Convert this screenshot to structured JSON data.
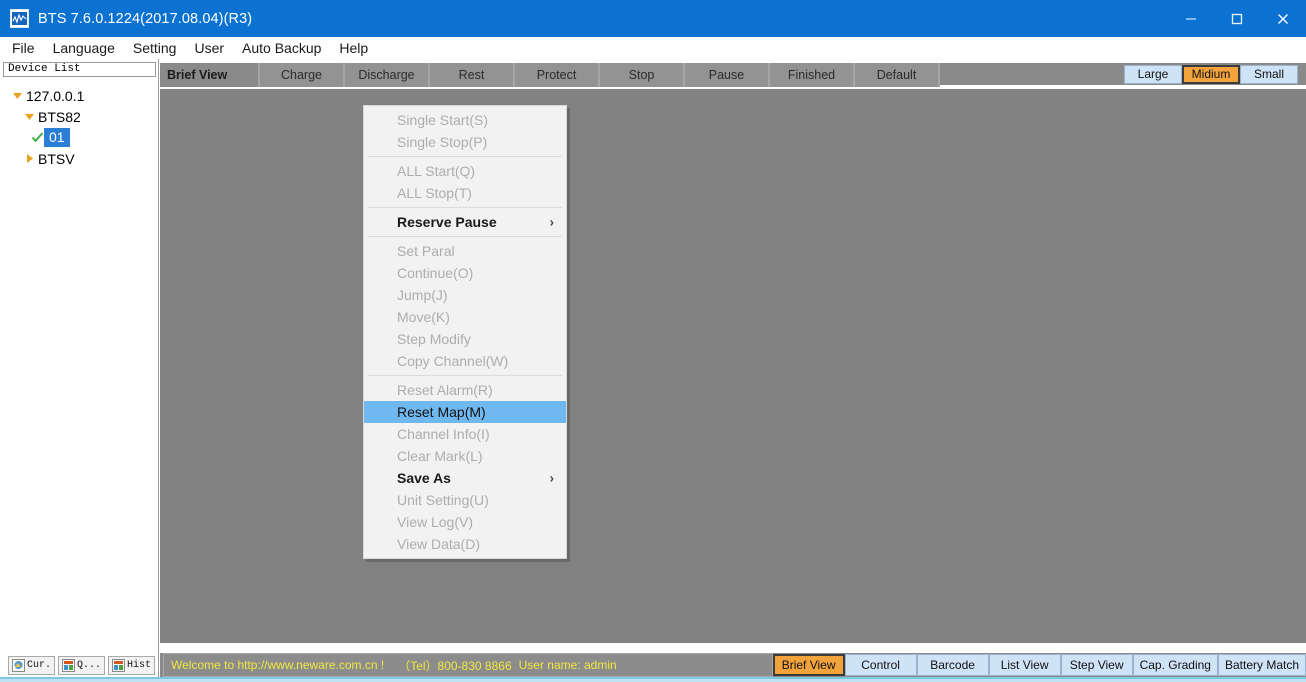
{
  "window": {
    "title": "BTS 7.6.0.1224(2017.08.04)(R3)",
    "app_icon": "bts-logo-icon",
    "minimize_label": "minimize-icon",
    "maximize_label": "maximize-icon",
    "close_label": "close-icon",
    "titlebar_color": "#0c72d1"
  },
  "menubar": {
    "items": [
      {
        "label": "File"
      },
      {
        "label": "Language"
      },
      {
        "label": "Setting"
      },
      {
        "label": "User"
      },
      {
        "label": "Auto Backup"
      },
      {
        "label": "Help"
      }
    ]
  },
  "sidebar": {
    "header": "Device List",
    "tree": [
      {
        "label": "127.0.0.1",
        "expander": "triangle-down",
        "depth": 0,
        "selected": false
      },
      {
        "label": "BTS82",
        "expander": "triangle-down",
        "depth": 1,
        "selected": false
      },
      {
        "label": "01",
        "expander": "check",
        "depth": 2,
        "selected": true
      },
      {
        "label": "BTSV",
        "expander": "triangle-right",
        "depth": 1,
        "selected": false
      }
    ],
    "taskbar": [
      {
        "label": "Cur.",
        "icon": "current-window-icon"
      },
      {
        "label": "Q...",
        "icon": "query-window-icon"
      },
      {
        "label": "Hist",
        "icon": "history-window-icon"
      }
    ]
  },
  "view_tabs": {
    "items": [
      {
        "label": "Brief View",
        "active": true
      },
      {
        "label": "Charge",
        "active": false
      },
      {
        "label": "Discharge",
        "active": false
      },
      {
        "label": "Rest",
        "active": false
      },
      {
        "label": "Protect",
        "active": false
      },
      {
        "label": "Stop",
        "active": false
      },
      {
        "label": "Pause",
        "active": false
      },
      {
        "label": "Finished",
        "active": false
      },
      {
        "label": "Default",
        "active": false
      }
    ],
    "size_buttons": [
      {
        "label": "Large",
        "active": false
      },
      {
        "label": "Midium",
        "active": true
      },
      {
        "label": "Small",
        "active": false
      }
    ]
  },
  "context_menu": {
    "items": [
      {
        "label": "Single Start(S)",
        "state": "disabled",
        "submenu": false
      },
      {
        "label": "Single Stop(P)",
        "state": "disabled",
        "submenu": false
      },
      {
        "label": "",
        "state": "separator",
        "submenu": false
      },
      {
        "label": "ALL Start(Q)",
        "state": "disabled",
        "submenu": false
      },
      {
        "label": "ALL Stop(T)",
        "state": "disabled",
        "submenu": false
      },
      {
        "label": "",
        "state": "separator",
        "submenu": false
      },
      {
        "label": "Reserve Pause",
        "state": "enabled",
        "submenu": true
      },
      {
        "label": "",
        "state": "separator",
        "submenu": false
      },
      {
        "label": "Set Paral",
        "state": "disabled",
        "submenu": false
      },
      {
        "label": "Continue(O)",
        "state": "disabled",
        "submenu": false
      },
      {
        "label": "Jump(J)",
        "state": "disabled",
        "submenu": false
      },
      {
        "label": "Move(K)",
        "state": "disabled",
        "submenu": false
      },
      {
        "label": "Step Modify",
        "state": "disabled",
        "submenu": false
      },
      {
        "label": "Copy Channel(W)",
        "state": "disabled",
        "submenu": false
      },
      {
        "label": "",
        "state": "separator",
        "submenu": false
      },
      {
        "label": "Reset Alarm(R)",
        "state": "disabled",
        "submenu": false
      },
      {
        "label": "Reset Map(M)",
        "state": "highlighted",
        "submenu": false
      },
      {
        "label": "Channel Info(I)",
        "state": "disabled",
        "submenu": false
      },
      {
        "label": "Clear Mark(L)",
        "state": "disabled",
        "submenu": false
      },
      {
        "label": "Save As",
        "state": "enabled",
        "submenu": true
      },
      {
        "label": "Unit Setting(U)",
        "state": "disabled",
        "submenu": false
      },
      {
        "label": "View Log(V)",
        "state": "disabled",
        "submenu": false
      },
      {
        "label": "View Data(D)",
        "state": "disabled",
        "submenu": false
      }
    ],
    "submenu_arrow": "chevron-right-icon",
    "highlight_color": "#70b8f0"
  },
  "statusbar": {
    "welcome": "Welcome to http://www.neware.com.cn !",
    "tel": "（Tel）800-830 8866",
    "user": "User name: admin",
    "text_color": "#efe93f",
    "buttons": [
      {
        "label": "Brief View",
        "active": true
      },
      {
        "label": "Control",
        "active": false
      },
      {
        "label": "Barcode",
        "active": false
      },
      {
        "label": "List View",
        "active": false
      },
      {
        "label": "Step View",
        "active": false
      },
      {
        "label": "Cap. Grading",
        "active": false
      },
      {
        "label": "Battery Match",
        "active": false
      }
    ]
  },
  "colors": {
    "accent_orange": "#f2a33c",
    "tab_blue": "#cfe3f7",
    "canvas_grey": "#828282",
    "selection_blue": "#2a7fd4"
  }
}
